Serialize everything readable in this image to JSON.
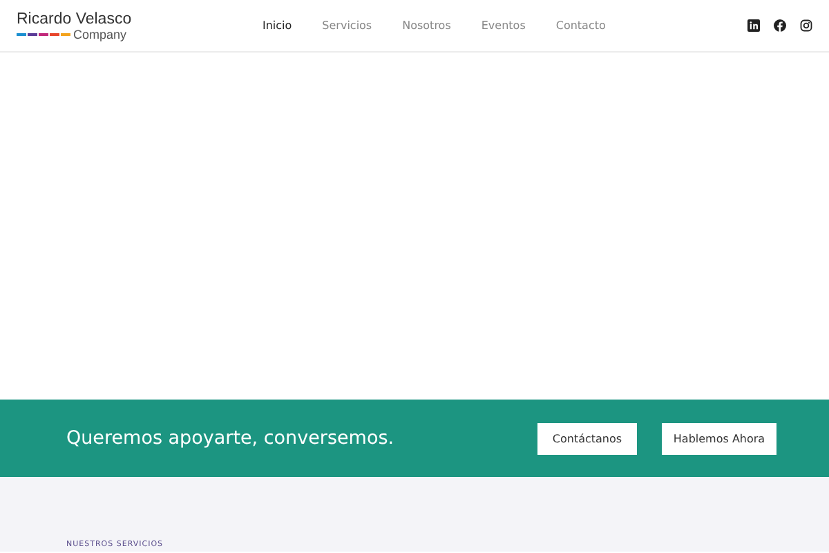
{
  "logo": {
    "name": "Ricardo Velasco",
    "sub": "Company"
  },
  "nav": [
    {
      "label": "Inicio",
      "selected": true
    },
    {
      "label": "Servicios",
      "selected": false
    },
    {
      "label": "Nosotros",
      "selected": false
    },
    {
      "label": "Eventos",
      "selected": false
    },
    {
      "label": "Contacto",
      "selected": false
    }
  ],
  "social": [
    {
      "kind": "linkedin"
    },
    {
      "kind": "facebook"
    },
    {
      "kind": "instagram"
    }
  ],
  "banner": {
    "text": "Queremos apoyarte, conversemos.",
    "buttons": [
      "Contáctanos",
      "Hablemos Ahora"
    ]
  },
  "section": {
    "eyebrow": "NUESTROS SERVICIOS"
  }
}
